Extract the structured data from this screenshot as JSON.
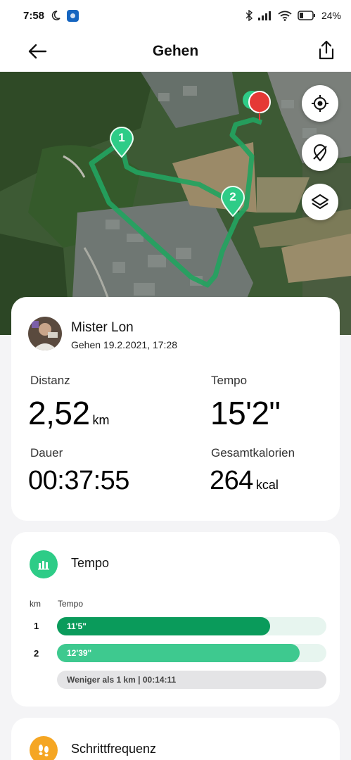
{
  "status": {
    "time": "7:58",
    "battery": "24%"
  },
  "header": {
    "title": "Gehen"
  },
  "map": {
    "markers": [
      "1",
      "2"
    ]
  },
  "user": {
    "name": "Mister Lon",
    "activity": "Gehen 19.2.2021, 17:28"
  },
  "metrics": {
    "distance": {
      "label": "Distanz",
      "value": "2,52",
      "unit": "km"
    },
    "pace": {
      "label": "Tempo",
      "value": "15'2\""
    },
    "duration": {
      "label": "Dauer",
      "value": "00:37:55"
    },
    "calories": {
      "label": "Gesamtkalorien",
      "value": "264",
      "unit": "kcal"
    }
  },
  "tempo": {
    "title": "Tempo",
    "col_km": "km",
    "col_tempo": "Tempo",
    "rows": [
      {
        "km": "1",
        "pace": "11'5\"",
        "fill": 0.79,
        "color": "#0a9b5b"
      },
      {
        "km": "2",
        "pace": "12'39\"",
        "fill": 0.9,
        "color": "#3ec98f"
      }
    ],
    "remainder": "Weniger als 1 km | 00:14:11"
  },
  "cadence": {
    "title": "Schrittfrequenz"
  },
  "colors": {
    "accent": "#2ecc87",
    "route": "#23a35f",
    "cadence": "#f5a623",
    "endpin": "#e53935"
  }
}
